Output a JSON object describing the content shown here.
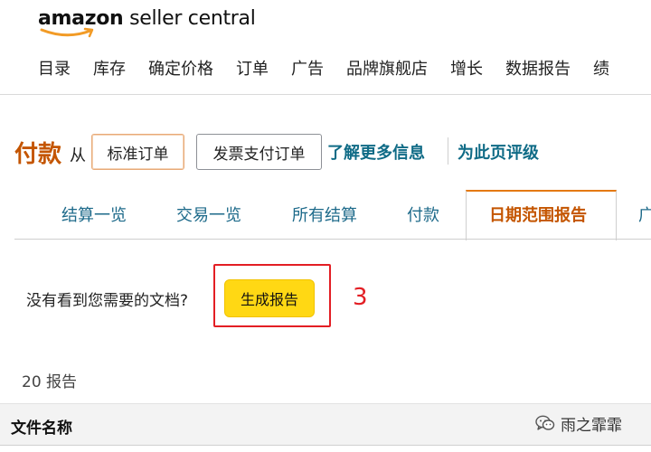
{
  "app": {
    "logo_brand": "amazon",
    "logo_suffix": " seller central"
  },
  "topnav": {
    "items": [
      "目录",
      "库存",
      "确定价格",
      "订单",
      "广告",
      "品牌旗舰店",
      "增长",
      "数据报告",
      "绩"
    ]
  },
  "title_row": {
    "title": "付款",
    "from": "从",
    "standard_orders": "标准订单",
    "invoiced_orders": "发票支付订单",
    "learn_more": "了解更多信息",
    "rate_page": "为此页评级"
  },
  "tabs": [
    "结算一览",
    "交易一览",
    "所有结算",
    "付款",
    "日期范围报告",
    "广"
  ],
  "active_tab": "日期范围报告",
  "report_prompt": {
    "text": "没有看到您需要的文档?",
    "generate_button": "生成报告",
    "step_number": "3"
  },
  "reports": {
    "count_text": "20 报告",
    "column_file_name": "文件名称"
  },
  "watermark": {
    "text": "雨之霏霏",
    "icon": "wechat-icon"
  },
  "colors": {
    "title_orange": "#c45500",
    "link_teal": "#0f6b86",
    "tab_blue": "#1d6a8a",
    "active_tab_border": "#e47911",
    "generate_yellow": "#ffd814",
    "annotation_red": "#e31e24"
  }
}
